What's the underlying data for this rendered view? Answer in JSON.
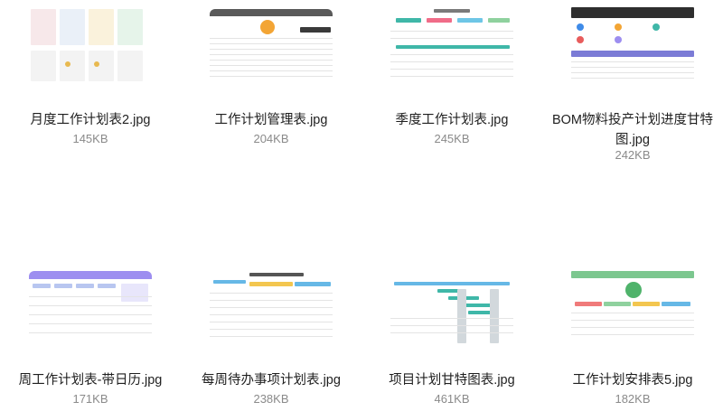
{
  "files": [
    {
      "name": "月度工作计划表2.jpg",
      "size": "145KB",
      "icon": "spreadsheet-thumbnail"
    },
    {
      "name": "工作计划管理表.jpg",
      "size": "204KB",
      "icon": "spreadsheet-thumbnail"
    },
    {
      "name": "季度工作计划表.jpg",
      "size": "245KB",
      "icon": "spreadsheet-thumbnail"
    },
    {
      "name": "BOM物料投产计划进度甘特图.jpg",
      "size": "242KB",
      "icon": "spreadsheet-thumbnail"
    },
    {
      "name": "周工作计划表-带日历.jpg",
      "size": "171KB",
      "icon": "spreadsheet-thumbnail"
    },
    {
      "name": "每周待办事项计划表.jpg",
      "size": "238KB",
      "icon": "spreadsheet-thumbnail"
    },
    {
      "name": "项目计划甘特图表.jpg",
      "size": "461KB",
      "icon": "spreadsheet-thumbnail"
    },
    {
      "name": "工作计划安排表5.jpg",
      "size": "182KB",
      "icon": "spreadsheet-thumbnail"
    }
  ],
  "colors": {
    "filename": "#1f1f1f",
    "filesize": "#8a8a8a",
    "teal": "#3fb7a8",
    "purple": "#9d8ef0",
    "dark_header": "#2e2e2e",
    "green_header": "#7cc78f",
    "blue_header": "#66b8e6"
  }
}
